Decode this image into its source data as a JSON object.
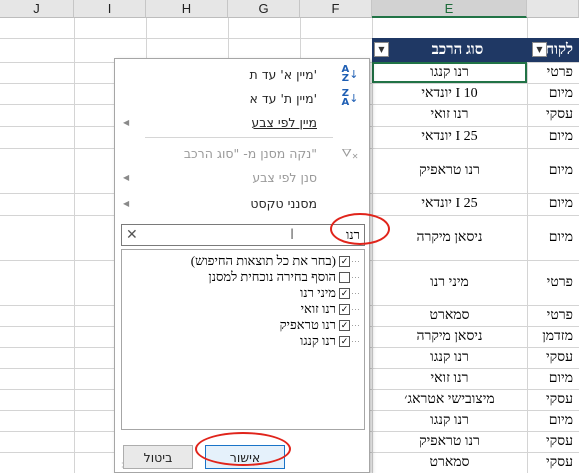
{
  "columns": [
    {
      "id": "J",
      "label": "J"
    },
    {
      "id": "I",
      "label": "I"
    },
    {
      "id": "H",
      "label": "H"
    },
    {
      "id": "G",
      "label": "G"
    },
    {
      "id": "F",
      "label": "F"
    },
    {
      "id": "E",
      "label": "E"
    }
  ],
  "header": {
    "colE": "סוג הרכב",
    "colD": "לקוח"
  },
  "rows": [
    {
      "e": "רנו קנגו",
      "d": "פרטי"
    },
    {
      "e": "יונדאי I 10",
      "d": "מיום"
    },
    {
      "e": "רנו זואי",
      "d": "עסקי"
    },
    {
      "e": "יונדאי I 25",
      "d": "מיום"
    },
    {
      "e": "רנו טראפיק",
      "d": "מיום"
    },
    {
      "e": "יונדאי I 25",
      "d": "מיום"
    },
    {
      "e": "ניסאן מיקרה",
      "d": "מיום"
    },
    {
      "e": "מיני רנו",
      "d": "פרטי"
    },
    {
      "e": "סמארט",
      "d": "פרטי"
    },
    {
      "e": "ניסאן מיקרה",
      "d": "מזדמן"
    },
    {
      "e": "רנו קנגו",
      "d": "עסקי"
    },
    {
      "e": "רנו זואי",
      "d": "מיום"
    },
    {
      "e": "מיצובישי אטראג׳",
      "d": "עסקי"
    },
    {
      "e": "רנו קנגו",
      "d": "מיום"
    },
    {
      "e": "רנו טראפיק",
      "d": "עסקי"
    },
    {
      "e": "סמארט",
      "d": "עסקי"
    }
  ],
  "menu": {
    "sort_az": "מיין א' עד ת'",
    "sort_za": "מיין ת' עד א'",
    "sort_by_color": "מיין לפי צבע",
    "clear_filter": "נקה מסנן מ- \"סוג הרכב\"",
    "filter_by_color": "סנן לפי צבע",
    "text_filters": "מסנני טקסט",
    "icon_sort_az_top": "A",
    "icon_sort_az_bottom": "Z",
    "icon_sort_za_top": "Z",
    "icon_sort_za_bottom": "A"
  },
  "search": {
    "value": "רנו"
  },
  "options": [
    {
      "label": "(בחר את כל תוצאות החיפוש)",
      "checked": true
    },
    {
      "label": "הוסף בחירה נוכחית למסנן",
      "checked": false
    },
    {
      "label": "מיני רנו",
      "checked": true
    },
    {
      "label": "רנו זואי",
      "checked": true
    },
    {
      "label": "רנו טראפיק",
      "checked": true
    },
    {
      "label": "רנו קנגו",
      "checked": true
    }
  ],
  "buttons": {
    "ok": "אישור",
    "cancel": "ביטול"
  },
  "colors": {
    "header_bg": "#1f3864",
    "excel_green": "#217346",
    "highlight_red": "#e0241b",
    "ok_border": "#1a74c8"
  }
}
